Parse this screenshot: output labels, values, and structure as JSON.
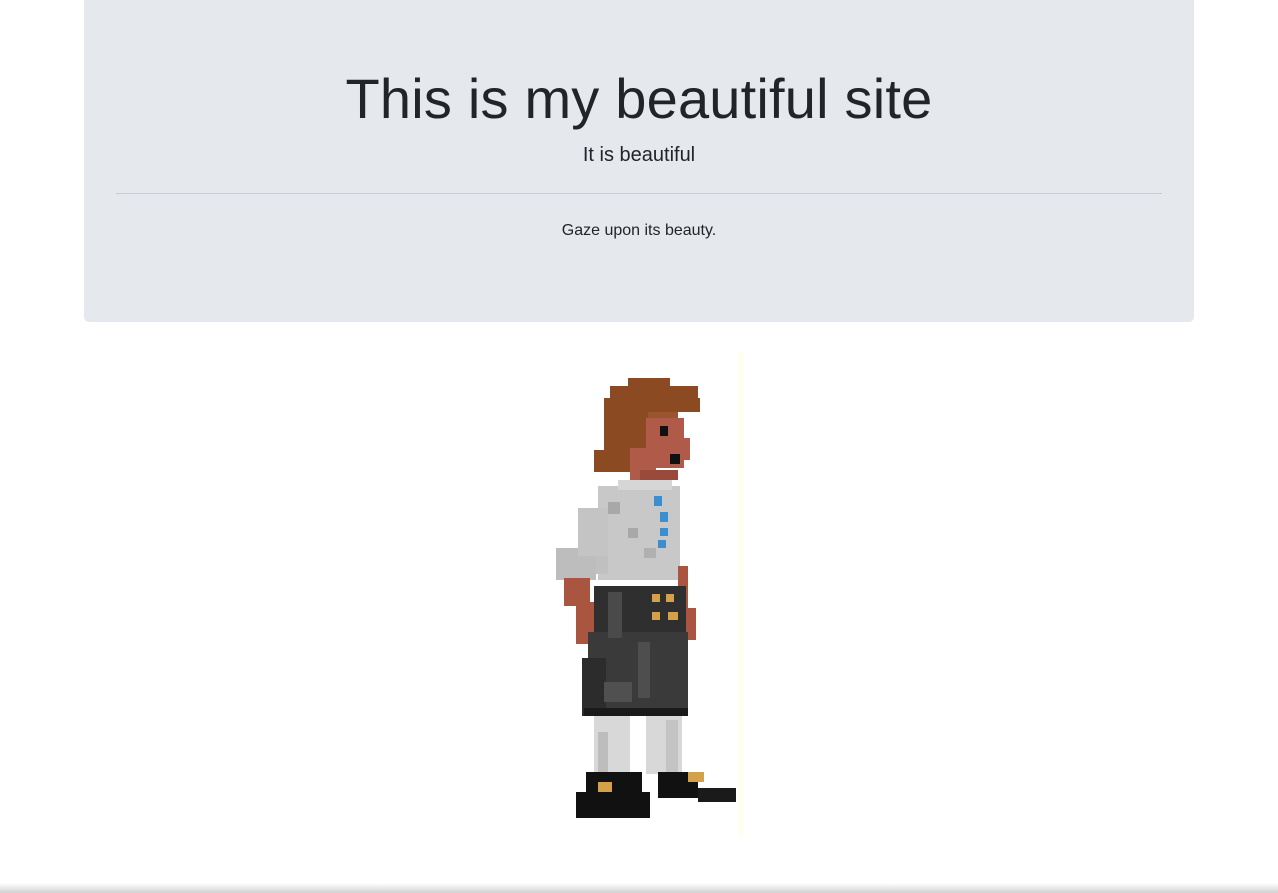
{
  "jumbotron": {
    "title": "This is my beautiful site",
    "lead": "It is beautiful",
    "text": "Gaze upon its beauty."
  },
  "image": {
    "icon": "pixel-art-pirate-character",
    "alt": ""
  },
  "colors": {
    "jumbotron_bg": "#e5e8ed",
    "text": "#212529",
    "hair": "#8b4a22",
    "skin": "#b05a4a",
    "shirt": "#c8c8c8",
    "shirt_buttons": "#3b8fd0",
    "trousers": "#3a3a3a",
    "belt_studs": "#d4a04a",
    "socks": "#d8d8d8",
    "shoes": "#111111"
  }
}
